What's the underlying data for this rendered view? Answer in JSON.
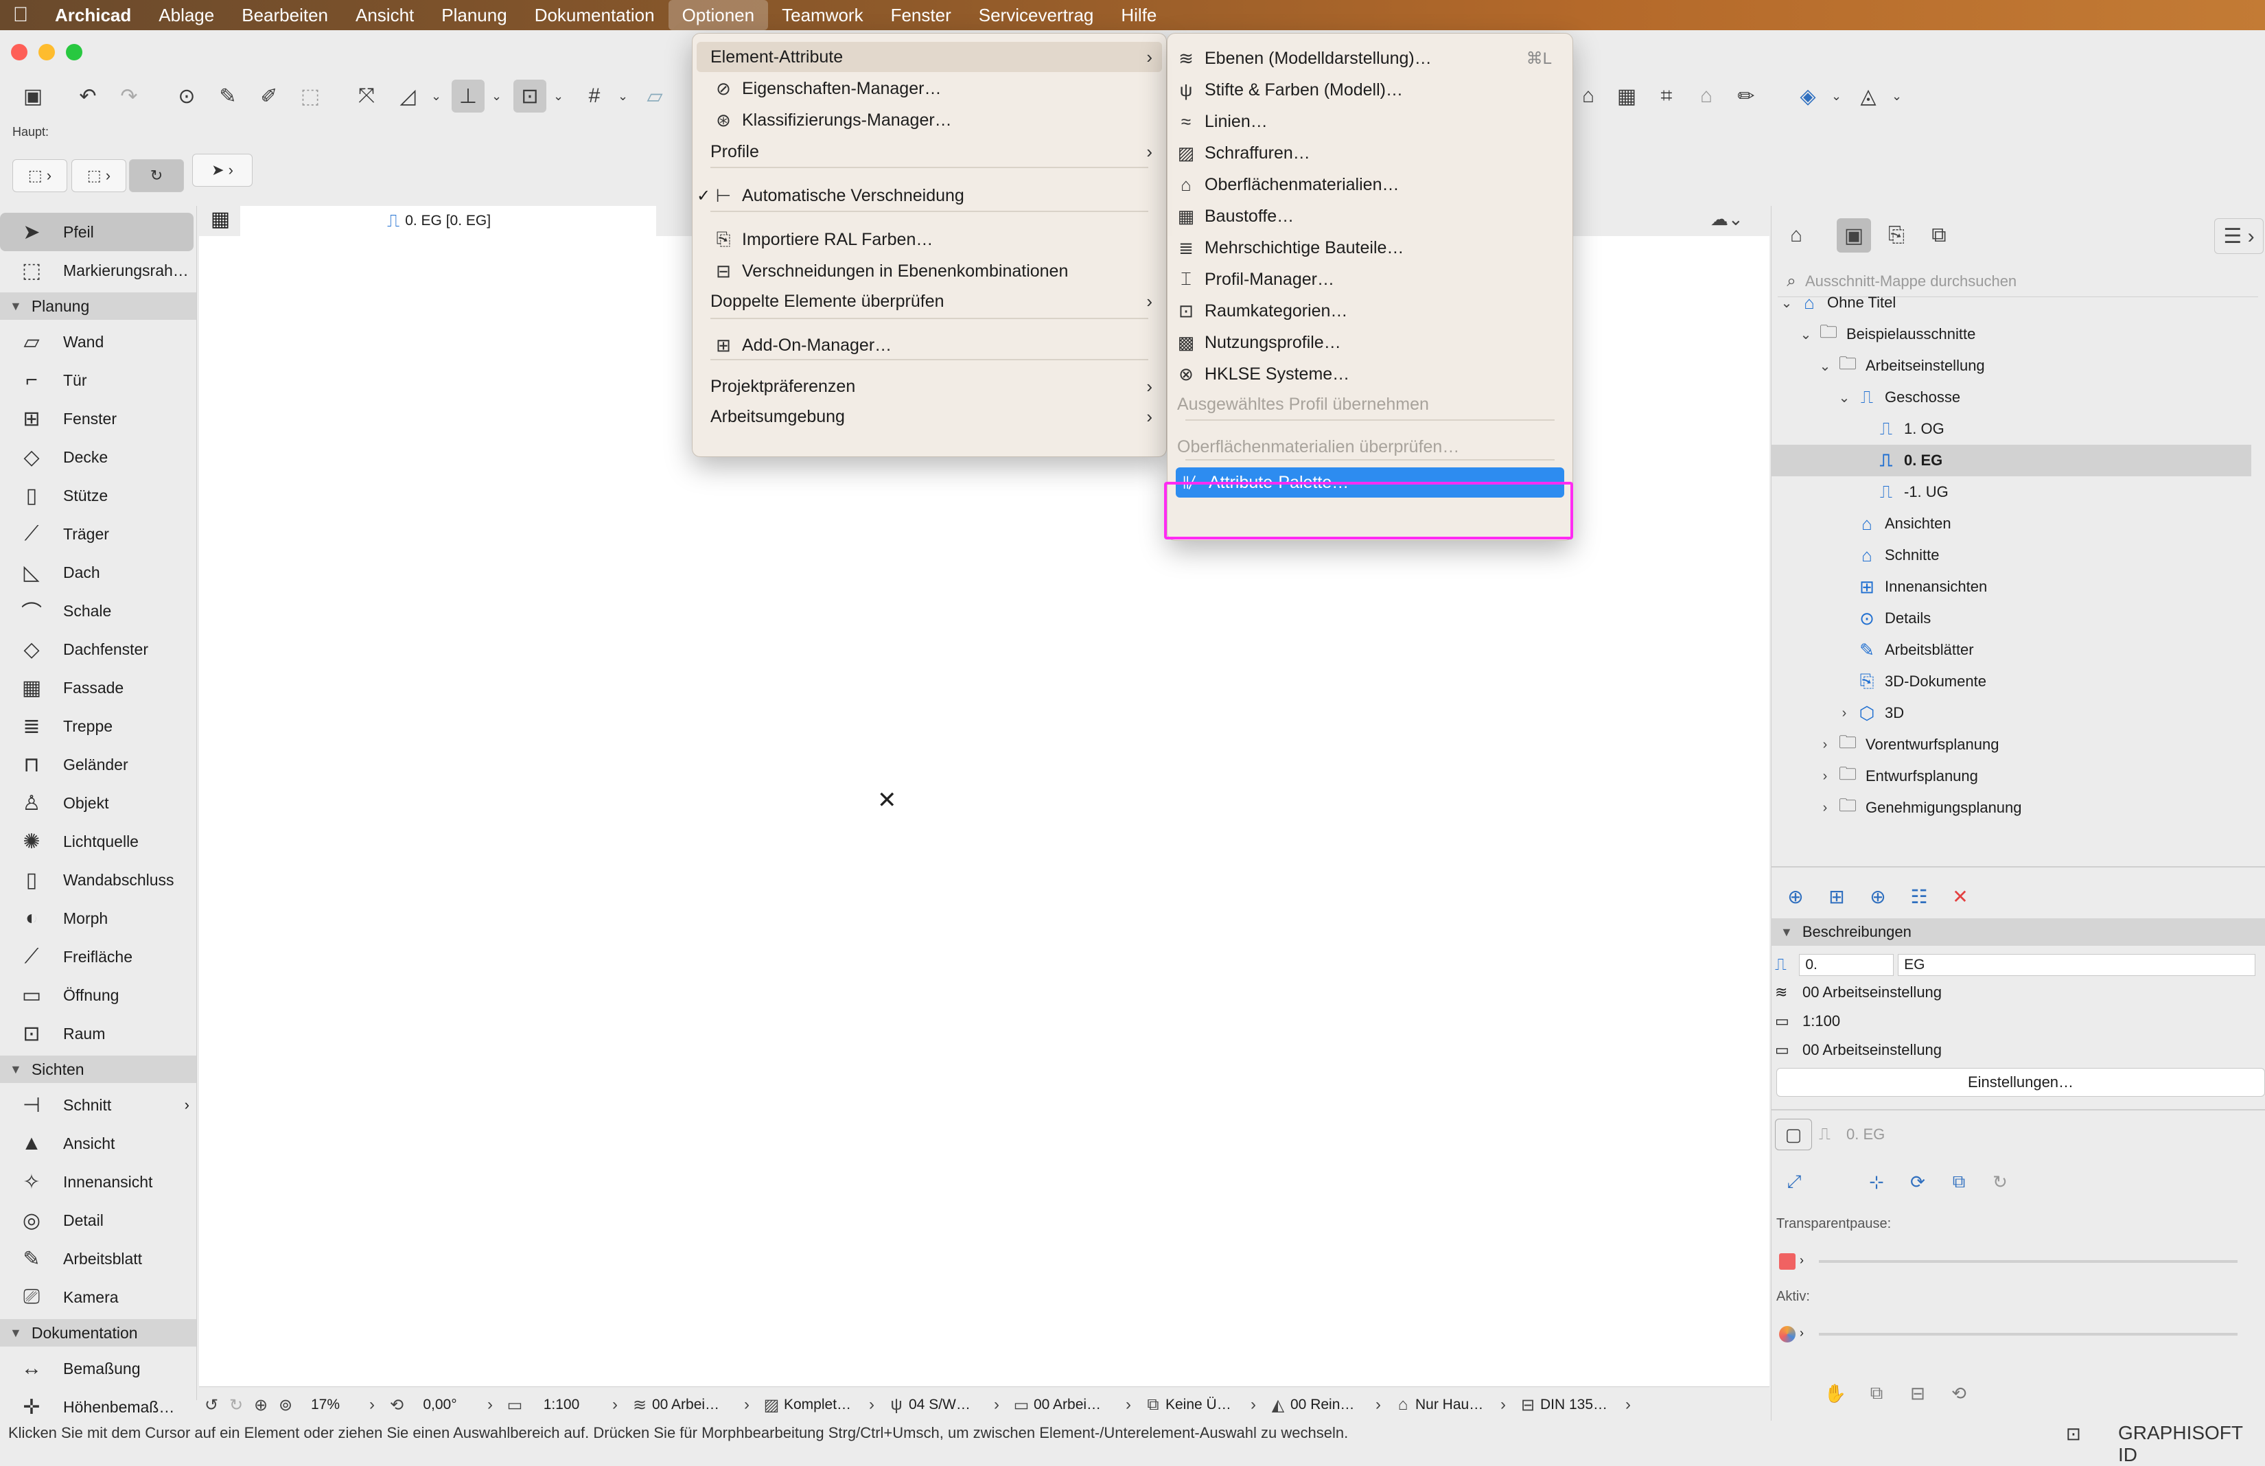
{
  "menubar": {
    "apple": "",
    "items": [
      "Archicad",
      "Ablage",
      "Bearbeiten",
      "Ansicht",
      "Planung",
      "Dokumentation",
      "Optionen",
      "Teamwork",
      "Fenster",
      "Servicevertrag",
      "Hilfe"
    ]
  },
  "toolbar": {
    "haupt_label": "Haupt:"
  },
  "toolbox": {
    "selected": "Pfeil",
    "top_items": [
      {
        "icon": "arrow-icon",
        "label": "Pfeil"
      },
      {
        "icon": "marquee-icon",
        "label": "Markierungsrah…"
      }
    ],
    "categories": [
      {
        "name": "Planung",
        "items": [
          "Wand",
          "Tür",
          "Fenster",
          "Decke",
          "Stütze",
          "Träger",
          "Dach",
          "Schale",
          "Dachfenster",
          "Fassade",
          "Treppe",
          "Geländer",
          "Objekt",
          "Lichtquelle",
          "Wandabschluss",
          "Morph",
          "Freifläche",
          "Öffnung",
          "Raum"
        ]
      },
      {
        "name": "Sichten",
        "items": [
          "Schnitt",
          "Ansicht",
          "Innenansicht",
          "Detail",
          "Arbeitsblatt",
          "Kamera"
        ]
      },
      {
        "name": "Dokumentation",
        "items": [
          "Bemaßung",
          "Höhenbemaß…"
        ]
      }
    ]
  },
  "canvas": {
    "tab_label": "0. EG [0. EG]"
  },
  "statusbar": {
    "zoom": "17%",
    "angle": "0,00°",
    "scale": "1:100",
    "layer": "00 Arbei…",
    "model": "Komplet…",
    "pen": "04 S/W…",
    "structure": "00 Arbei…",
    "override": "Keine Ü…",
    "renovation": "00 Rein…",
    "structure2": "Nur Hau…",
    "paper": "DIN 135…"
  },
  "hint": "Klicken Sie mit dem Cursor auf ein Element oder ziehen Sie einen Auswahlbereich auf. Drücken Sie für Morphbearbeitung Strg/Ctrl+Umsch, um zwischen Element-/Unterelement-Auswahl zu wechseln.",
  "brand": "GRAPHISOFT ID",
  "optionen_menu": {
    "items": [
      {
        "label": "Element-Attribute",
        "submenu": true,
        "highlighted": true
      },
      {
        "label": "Eigenschaften-Manager…",
        "icon": "tag-icon"
      },
      {
        "label": "Klassifizierungs-Manager…",
        "icon": "classification-icon"
      },
      {
        "label": "Profile",
        "submenu": true
      },
      {
        "label": "Automatische Verschneidung",
        "icon": "intersection-icon",
        "checked": true
      },
      {
        "label": "Importiere RAL Farben…",
        "icon": "ral-icon"
      },
      {
        "label": "Verschneidungen in Ebenenkombinationen",
        "icon": "layer-intersect-icon"
      },
      {
        "label": "Doppelte Elemente überprüfen",
        "submenu": true
      },
      {
        "label": "Add-On-Manager…",
        "icon": "puzzle-icon"
      },
      {
        "label": "Projektpräferenzen",
        "submenu": true
      },
      {
        "label": "Arbeitsumgebung",
        "submenu": true
      }
    ],
    "check_mark": "✓"
  },
  "attribute_submenu": {
    "items": [
      {
        "label": "Ebenen (Modelldarstellung)…",
        "icon": "layers-icon",
        "shortcut": "⌘L"
      },
      {
        "label": "Stifte & Farben (Modell)…",
        "icon": "pen-icon"
      },
      {
        "label": "Linien…",
        "icon": "line-type-icon"
      },
      {
        "label": "Schraffuren…",
        "icon": "hatch-icon"
      },
      {
        "label": "Oberflächenmaterialien…",
        "icon": "surface-icon"
      },
      {
        "label": "Baustoffe…",
        "icon": "building-material-icon"
      },
      {
        "label": "Mehrschichtige Bauteile…",
        "icon": "composite-icon"
      },
      {
        "label": "Profil-Manager…",
        "icon": "profile-icon"
      },
      {
        "label": "Raumkategorien…",
        "icon": "zone-category-icon"
      },
      {
        "label": "Nutzungsprofile…",
        "icon": "operation-profile-icon"
      },
      {
        "label": "HKLSE Systeme…",
        "icon": "mep-icon"
      },
      {
        "label": "Ausgewähltes Profil übernehmen",
        "disabled": true
      },
      {
        "label": "Oberflächenmaterialien überprüfen…",
        "disabled": true
      },
      {
        "label": "Attribute-Palette…",
        "icon": "attribute-palette-icon",
        "selected": true
      }
    ]
  },
  "navigator": {
    "search_placeholder": "Ausschnitt-Mappe durchsuchen",
    "tree": [
      {
        "label": "Ohne Titel",
        "level": 0,
        "toggle": "open",
        "icon": "project-icon"
      },
      {
        "label": "Beispielausschnitte",
        "level": 1,
        "toggle": "open",
        "icon": "folder-icon"
      },
      {
        "label": "Arbeitseinstellung",
        "level": 2,
        "toggle": "open",
        "icon": "folder-icon"
      },
      {
        "label": "Geschosse",
        "level": 3,
        "toggle": "open",
        "icon": "stories-icon"
      },
      {
        "label": "1. OG",
        "level": 4,
        "icon": "story-icon"
      },
      {
        "label": "0. EG",
        "level": 4,
        "icon": "story-icon",
        "selected": true
      },
      {
        "label": "-1. UG",
        "level": 4,
        "icon": "story-icon"
      },
      {
        "label": "Ansichten",
        "level": 3,
        "icon": "elevation-icon"
      },
      {
        "label": "Schnitte",
        "level": 3,
        "icon": "section-icon"
      },
      {
        "label": "Innenansichten",
        "level": 3,
        "icon": "interior-elevation-icon"
      },
      {
        "label": "Details",
        "level": 3,
        "icon": "detail-icon"
      },
      {
        "label": "Arbeitsblätter",
        "level": 3,
        "icon": "worksheet-icon"
      },
      {
        "label": "3D-Dokumente",
        "level": 3,
        "icon": "3d-document-icon"
      },
      {
        "label": "3D",
        "level": 3,
        "toggle": "closed",
        "icon": "3d-icon"
      },
      {
        "label": "Vorentwurfsplanung",
        "level": 2,
        "toggle": "closed",
        "icon": "folder-icon"
      },
      {
        "label": "Entwurfsplanung",
        "level": 2,
        "toggle": "closed",
        "icon": "folder-icon"
      },
      {
        "label": "Genehmigungsplanung",
        "level": 2,
        "toggle": "closed",
        "icon": "folder-icon"
      }
    ],
    "descriptions_title": "Beschreibungen",
    "desc_id": "0.",
    "desc_name": "EG",
    "desc_layer": "00 Arbeitseinstellung",
    "desc_scale": "1:100",
    "desc_structure": "00 Arbeitseinstellung",
    "settings_button": "Einstellungen…",
    "prop_view": "0. EG",
    "transparent_label": "Transparentpause:",
    "active_label": "Aktiv:",
    "accent_red": "#f06262"
  }
}
